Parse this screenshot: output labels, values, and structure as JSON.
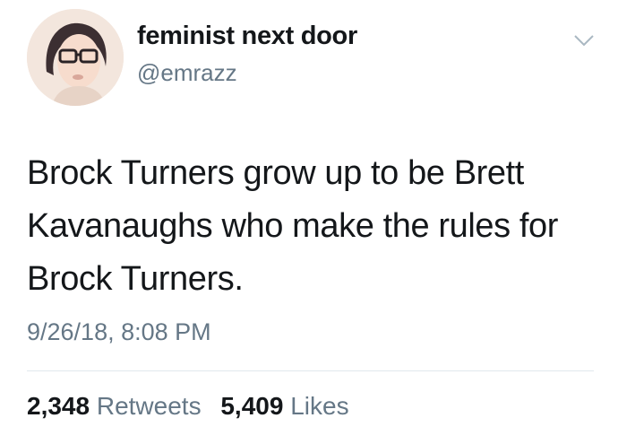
{
  "user": {
    "display_name": "feminist next door",
    "handle": "@emrazz"
  },
  "tweet": {
    "text": "Brock Turners grow up to be Brett Kavanaughs who make the rules for Brock Turners.",
    "timestamp": "9/26/18, 8:08 PM"
  },
  "stats": {
    "retweets_count": "2,348",
    "retweets_label": "Retweets",
    "likes_count": "5,409",
    "likes_label": "Likes"
  },
  "icons": {
    "menu": "chevron-down-icon"
  },
  "colors": {
    "primary_text": "#14171a",
    "secondary_text": "#657786",
    "divider": "#e1e8ed"
  }
}
